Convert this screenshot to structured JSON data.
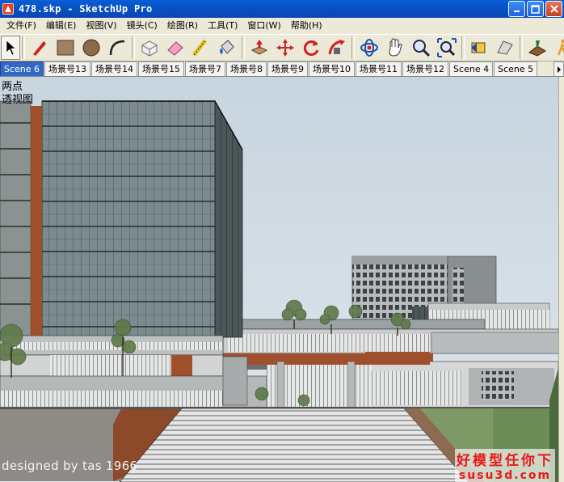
{
  "window": {
    "title": "478.skp - SketchUp Pro",
    "controls": [
      "minimize",
      "maximize",
      "close"
    ]
  },
  "menu": [
    "文件(F)",
    "编辑(E)",
    "视图(V)",
    "镜头(C)",
    "绘图(R)",
    "工具(T)",
    "窗口(W)",
    "帮助(H)"
  ],
  "toolbar": {
    "tools": [
      {
        "name": "select-tool-icon"
      },
      {
        "name": "pencil-line-tool-icon"
      },
      {
        "name": "rectangle-tool-icon"
      },
      {
        "name": "circle-tool-icon"
      },
      {
        "name": "arc-tool-icon"
      },
      {
        "name": "make-component-icon"
      },
      {
        "name": "eraser-tool-icon"
      },
      {
        "name": "tape-measure-tool-icon"
      },
      {
        "name": "paint-bucket-tool-icon"
      },
      {
        "name": "push-pull-tool-icon"
      },
      {
        "name": "move-tool-icon"
      },
      {
        "name": "rotate-tool-icon"
      },
      {
        "name": "follow-me-tool-icon"
      },
      {
        "name": "orbit-tool-icon"
      },
      {
        "name": "pan-tool-icon"
      },
      {
        "name": "zoom-tool-icon"
      },
      {
        "name": "zoom-extents-icon"
      },
      {
        "name": "previous-view-icon"
      },
      {
        "name": "next-view-icon"
      },
      {
        "name": "sandbox-tool-icon"
      },
      {
        "name": "walk-tool-icon"
      }
    ]
  },
  "scenes": {
    "tabs": [
      "Scene 6",
      "场景号13",
      "场景号14",
      "场景号15",
      "场景号7",
      "场景号8",
      "场景号9",
      "场景号10",
      "场景号11",
      "场景号12",
      "Scene 4",
      "Scene 5"
    ],
    "active_index": 0
  },
  "viewport": {
    "perspective_line1": "两点",
    "perspective_line2": "透视图",
    "signature": "designed by tas  1966",
    "watermark_cn": "好模型任你下",
    "watermark_en": "susu3d.com",
    "sky_color": "#cdd9e2",
    "glass_color": "#7a8a8c",
    "terracotta_color": "#a0512e"
  }
}
